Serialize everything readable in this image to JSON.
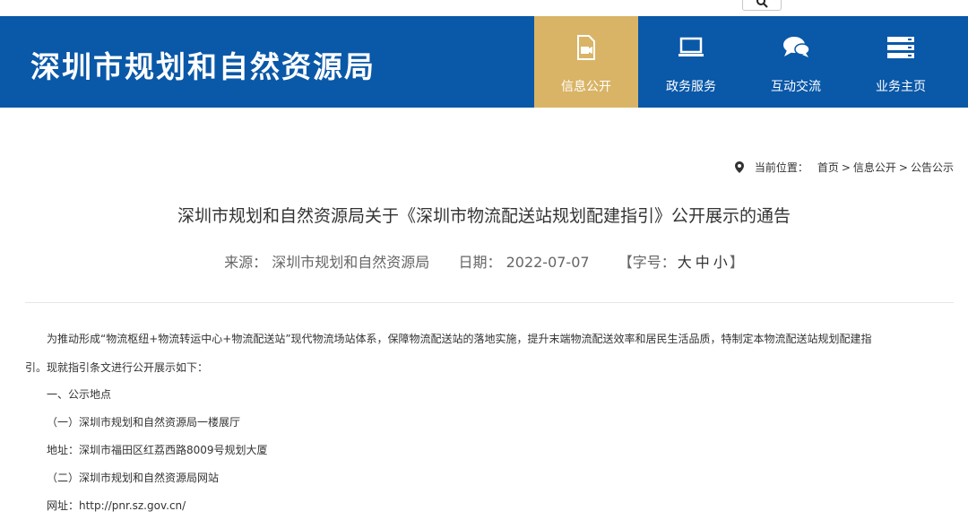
{
  "header": {
    "site_title": "深圳市规划和自然资源局",
    "nav": [
      {
        "label": "信息公开",
        "icon": "document-video-icon",
        "active": true
      },
      {
        "label": "政务服务",
        "icon": "monitor-icon",
        "active": false
      },
      {
        "label": "互动交流",
        "icon": "chat-bubbles-icon",
        "active": false
      },
      {
        "label": "业务主页",
        "icon": "server-list-icon",
        "active": false
      }
    ],
    "search_icon": "search-icon"
  },
  "breadcrumb": {
    "prefix": "当前位置：",
    "items": [
      "首页",
      "信息公开",
      "公告公示"
    ],
    "separator": ">"
  },
  "article": {
    "title": "深圳市规划和自然资源局关于《深圳市物流配送站规划配建指引》公开展示的通告",
    "source_label": "来源：",
    "source": "深圳市规划和自然资源局",
    "date_label": "日期：",
    "date": "2022-07-07",
    "font_label_open": "【字号：",
    "font_sizes": [
      "大",
      "中",
      "小"
    ],
    "font_label_close": "】",
    "paragraphs": [
      "为推动形成“物流枢纽+物流转运中心+物流配送站”现代物流场站体系，保障物流配送站的落地实施，提升末端物流配送效率和居民生活品质，特制定本物流配送站规划配建指",
      "引。现就指引条文进行公开展示如下：",
      "一、公示地点",
      "（一）深圳市规划和自然资源局一楼展厅",
      "地址：深圳市福田区红荔西路8009号规划大厦",
      "（二）深圳市规划和自然资源局网站",
      "网址：http://pnr.sz.gov.cn/"
    ]
  },
  "colors": {
    "header_bg": "#0a58a8",
    "nav_active_bg": "#d9b466",
    "text": "#333333"
  }
}
